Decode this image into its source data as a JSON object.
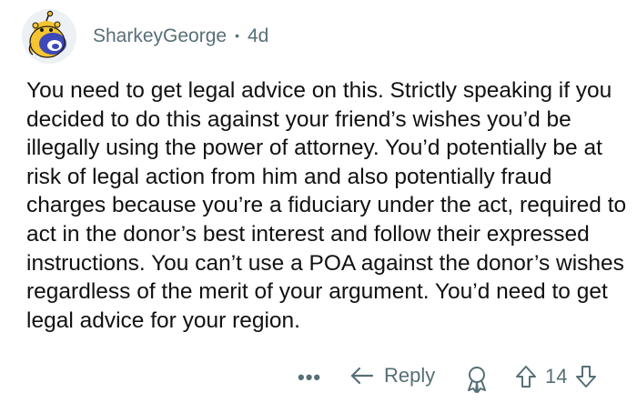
{
  "comment": {
    "username": "SharkeyGeorge",
    "separator": "•",
    "age": "4d",
    "avatar_icon": "snoo-avatar-icon",
    "body": "You need to get legal advice on this. Strictly speaking if you decided to do this against your friend’s wishes you’d be illegally using the power of attorney. You’d potentially be at risk of legal action from him and also potentially fraud charges because you’re a fiduciary under the act, required to act in the donor’s best interest and follow their expressed instructions. You can’t use a POA against the donor’s wishes regardless of the merit of your argument. You’d need to get legal advice for your region."
  },
  "actions": {
    "more_label": "•••",
    "reply_label": "Reply",
    "vote_count": "14",
    "icons": {
      "more": "more-icon",
      "reply": "reply-arrow-icon",
      "award": "award-icon",
      "upvote": "upvote-arrow-icon",
      "downvote": "downvote-arrow-icon"
    }
  },
  "colors": {
    "meta_text": "#576f76",
    "body_text": "#111111",
    "avatar_accent": "#f5c431",
    "avatar_blue": "#3d49b8"
  }
}
